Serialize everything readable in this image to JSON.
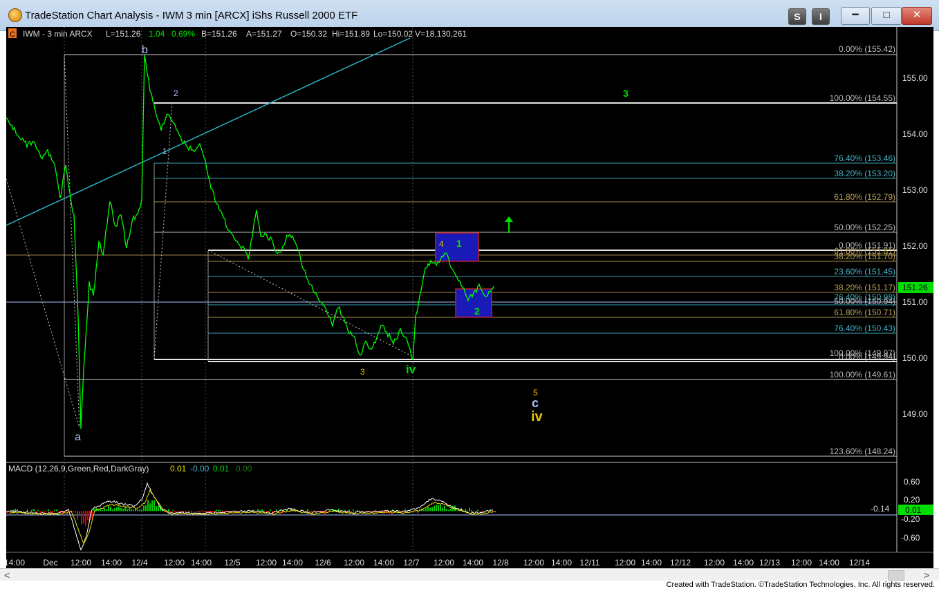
{
  "window": {
    "title": "TradeStation Chart Analysis - IWM 3 min [ARCX] iShs Russell 2000 ETF",
    "btn_s": "S",
    "btn_i": "I",
    "min": "━",
    "max": "□",
    "close": "✕"
  },
  "footer": "Created with TradeStation. ©TradeStation Technologies, Inc. All rights reserved.",
  "colors": {
    "price": "#00ff00",
    "background": "#000000",
    "fib_teal": "#43b4c7",
    "fib_olive": "#b8a25a",
    "fib_white": "#dddddd",
    "label_blue": "#aec6ff"
  },
  "header": {
    "c_icon": "C",
    "symbol": "IWM - 3 min  ARCX",
    "last": "L=151.26",
    "change": "1.04",
    "pct": "0.69%",
    "bid": "B=151.26",
    "ask": "A=151.27",
    "open": "O=150.32",
    "high": "Hi=151.89",
    "low": "Lo=150.02",
    "volume": "V=18,130,261"
  },
  "price_axis": {
    "ticks": [
      "155.00",
      "154.00",
      "153.00",
      "152.00",
      "151.00",
      "150.00",
      "149.00"
    ],
    "last_badge": "151.26"
  },
  "fib_levels": [
    {
      "text": "0.00% (155.42)",
      "color": "#bbbbbb"
    },
    {
      "text": "100.00% (154.55)",
      "color": "#bbbbbb"
    },
    {
      "text": "76.40% (153.46)",
      "color": "#43b4c7"
    },
    {
      "text": "38.20% (153.20)",
      "color": "#43b4c7"
    },
    {
      "text": "61.80% (152.79)",
      "color": "#b8a25a"
    },
    {
      "text": "50.00% (152.25)",
      "color": "#bbbbbb"
    },
    {
      "text": "0.00% (151.91)",
      "color": "#bbbbbb"
    },
    {
      "text": "61.80% (151.81)",
      "color": "#b8a25a"
    },
    {
      "text": "38.20% (151.70)",
      "color": "#b8a25a"
    },
    {
      "text": "23.60% (151.45)",
      "color": "#43b4c7"
    },
    {
      "text": "38.20% (151.17)",
      "color": "#b8a25a"
    },
    {
      "text": "76.40% (150.98)",
      "color": "#43b4c7"
    },
    {
      "text": "50.00% (150.94)",
      "color": "#bbbbbb"
    },
    {
      "text": "61.80% (150.71)",
      "color": "#b8a25a"
    },
    {
      "text": "76.40% (150.43)",
      "color": "#43b4c7"
    },
    {
      "text": "100.00% (149.97)",
      "color": "#bbbbbb"
    },
    {
      "text": "0.00% (149.94)",
      "color": "#bbbbbb"
    },
    {
      "text": "100.00% (149.61)",
      "color": "#bbbbbb"
    },
    {
      "text": "123.60% (148.24)",
      "color": "#bbbbbb"
    }
  ],
  "wave_labels": [
    {
      "text": "b",
      "color": "#aec6ff"
    },
    {
      "text": "2",
      "color": "#aec6ff"
    },
    {
      "text": "1",
      "color": "#aec6ff"
    },
    {
      "text": "a",
      "color": "#aec6ff"
    },
    {
      "text": "3",
      "color": "#e6c200"
    },
    {
      "text": "iv",
      "color": "#00e000"
    },
    {
      "text": "4",
      "color": "#e6c200"
    },
    {
      "text": "1",
      "color": "#00e000"
    },
    {
      "text": "2",
      "color": "#00e000"
    },
    {
      "text": "3",
      "color": "#00e000"
    },
    {
      "text": "5",
      "color": "#e6c200"
    },
    {
      "text": "c",
      "color": "#aec6ff"
    },
    {
      "text": "iv",
      "color": "#e6c200"
    }
  ],
  "macd": {
    "label": "MACD (12,26,9,Green,Red,DarkGray)",
    "v1": "0.01",
    "v2": "-0.00",
    "v3": "0.01",
    "v4": "0.00",
    "ticks": [
      "0.60",
      "0.20",
      "-0.20",
      "-0.60"
    ],
    "level_label": "-0.14",
    "badge": "0.01"
  },
  "time_axis": [
    "14:00",
    "Dec",
    "12:00",
    "14:00",
    "12/4",
    "12:00",
    "14:00",
    "12/5",
    "12:00",
    "14:00",
    "12/6",
    "12:00",
    "14:00",
    "12/7",
    "12:00",
    "14:00",
    "12/8",
    "12:00",
    "14:00",
    "12/11",
    "12:00",
    "14:00",
    "12/12",
    "12:00",
    "14:00",
    "12/13",
    "12:00",
    "14:00",
    "12/14"
  ]
}
